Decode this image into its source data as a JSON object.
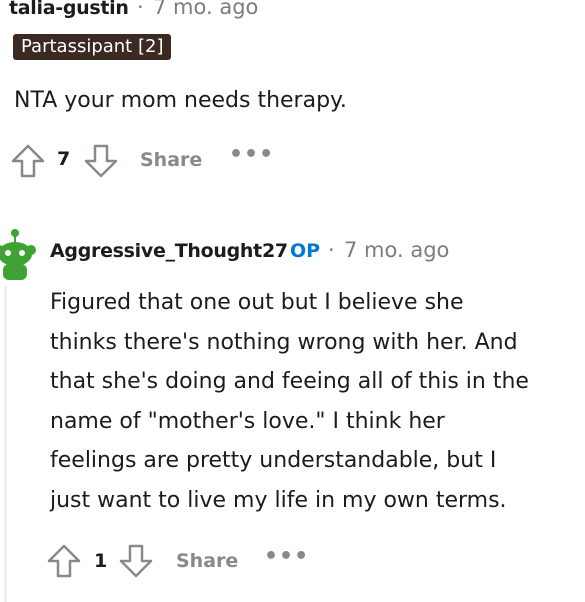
{
  "comment1": {
    "username": "talia-gustin",
    "separator": "·",
    "timestamp": "7 mo. ago",
    "flair": "Partassipant [2]",
    "body": "NTA your mom needs therapy.",
    "votes": "7",
    "share_label": "Share",
    "more_label": "•••"
  },
  "comment2": {
    "username": "Aggressive_Thought27",
    "op_badge": "OP",
    "separator": "·",
    "timestamp": "7 mo. ago",
    "body_lines": [
      "Figured that one out but I believe she",
      "thinks there's nothing wrong with her. And",
      "that she's doing and feeing all of this in the",
      "name of \"mother's love.\" I think her",
      "feelings are pretty understandable, but I",
      "just want to live my life in my own terms."
    ],
    "votes": "1",
    "share_label": "Share",
    "more_label": "•••"
  },
  "colors": {
    "flair_bg": "#3a2a22",
    "op_blue": "#0079d3",
    "avatar_green": "#3ea234"
  }
}
